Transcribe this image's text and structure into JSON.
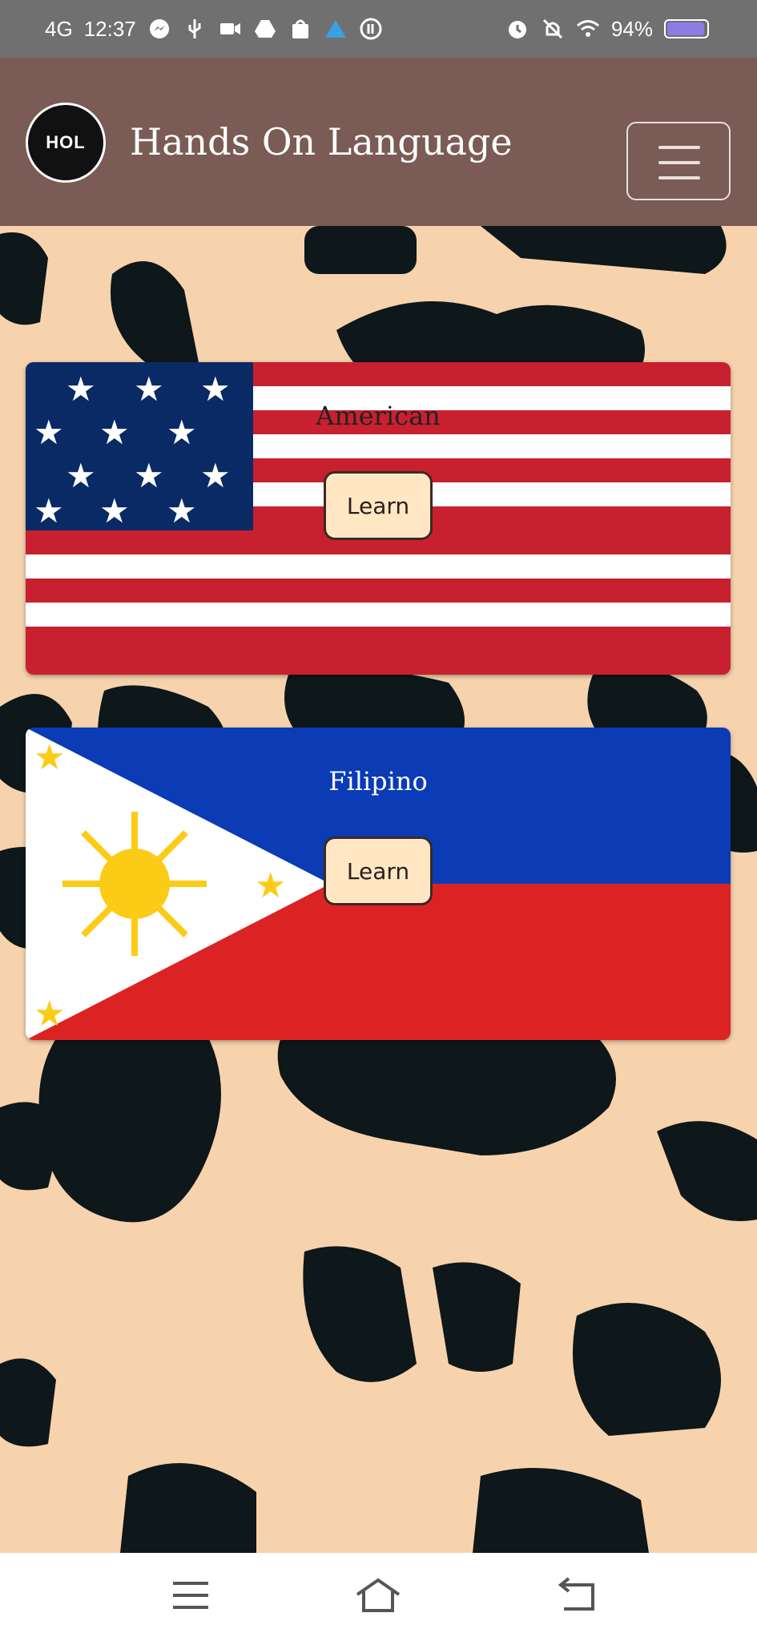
{
  "status_bar": {
    "network": "4G",
    "time": "12:37",
    "battery_percent": "94%"
  },
  "navbar": {
    "logo_text": "HOL",
    "brand": "Hands On Language"
  },
  "cards": [
    {
      "title": "American",
      "button": "Learn"
    },
    {
      "title": "Filipino",
      "button": "Learn"
    }
  ],
  "colors": {
    "navbar_bg": "#7a5b55",
    "page_bg": "#f6d3ad",
    "button_bg": "#ffe7c4"
  },
  "bottom_nav": {
    "menu": "menu-icon",
    "home": "home-icon",
    "back": "back-icon"
  }
}
